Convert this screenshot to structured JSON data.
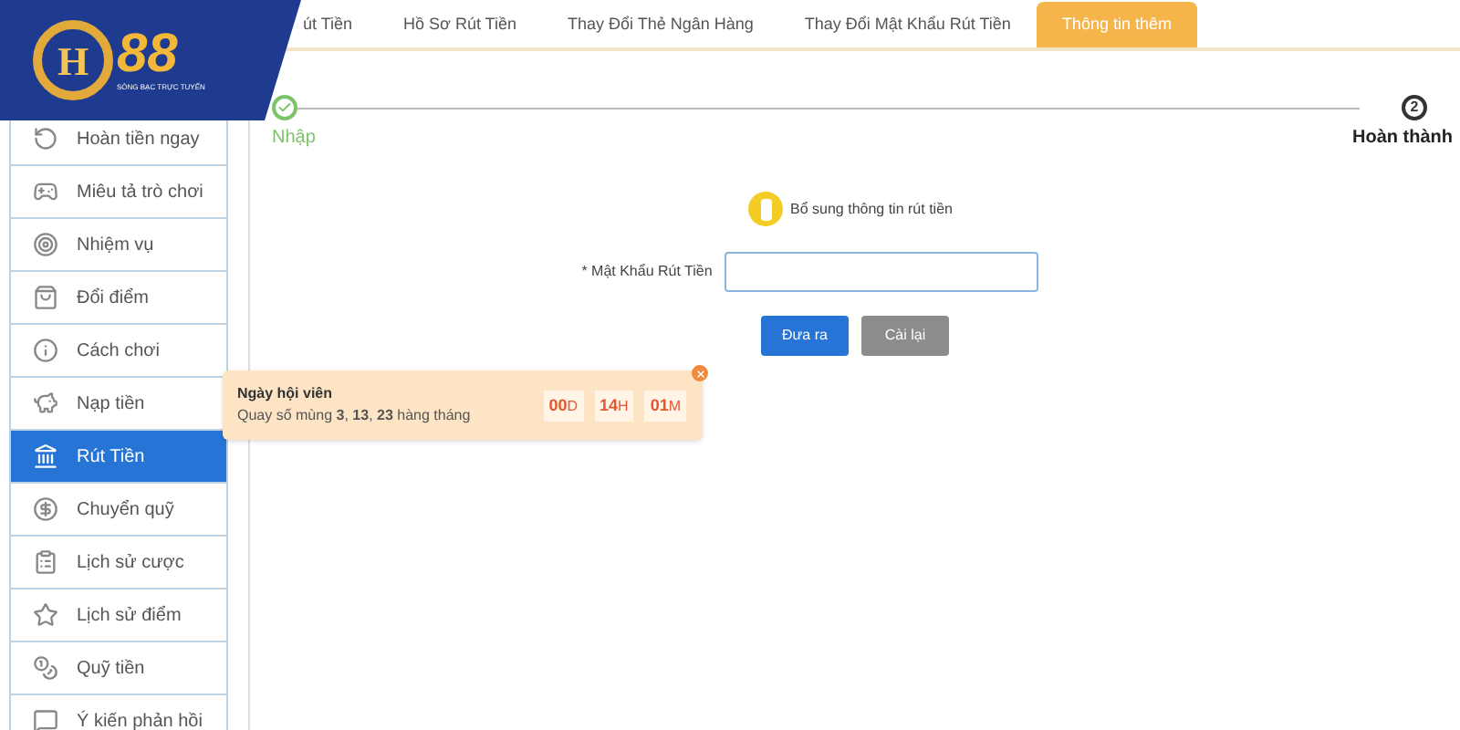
{
  "logo": {
    "letter": "H",
    "number": "88",
    "tagline": "SÒNG BẠC TRỰC TUYẾN"
  },
  "tabs": [
    {
      "label": "út Tiền",
      "selected": false
    },
    {
      "label": "Hồ Sơ Rút Tiền",
      "selected": false
    },
    {
      "label": "Thay Đổi Thẻ Ngân Hàng",
      "selected": false
    },
    {
      "label": "Thay Đổi Mật Khẩu Rút Tiền",
      "selected": false
    },
    {
      "label": "Thông tin thêm",
      "selected": true
    }
  ],
  "sidebar": {
    "items": [
      {
        "label": "Hoàn tiền ngay",
        "selected": false
      },
      {
        "label": "Miêu tả trò chơi",
        "selected": false
      },
      {
        "label": "Nhiệm vụ",
        "selected": false
      },
      {
        "label": "Đổi điểm",
        "selected": false
      },
      {
        "label": "Cách chơi",
        "selected": false
      },
      {
        "label": "Nạp tiền",
        "selected": false
      },
      {
        "label": "Rút Tiền",
        "selected": true
      },
      {
        "label": "Chuyển quỹ",
        "selected": false
      },
      {
        "label": "Lịch sử cược",
        "selected": false
      },
      {
        "label": "Lịch sử điểm",
        "selected": false
      },
      {
        "label": "Quỹ tiền",
        "selected": false
      },
      {
        "label": "Ý kiến phản hồi",
        "selected": false
      }
    ]
  },
  "steps": [
    {
      "label": "Nhập",
      "done": true
    },
    {
      "label": "Hoàn thành",
      "marker": "2",
      "done": false
    }
  ],
  "notice": "Bổ sung thông tin rút tiền",
  "form": {
    "label": "* Mật Khẩu Rút Tiền"
  },
  "buttons": [
    {
      "label": "Đưa ra",
      "kind": "primary"
    },
    {
      "label": "Cài lại",
      "kind": "secondary"
    }
  ],
  "promo": {
    "title": "Ngày hội viên",
    "text": "Quay số mùng **3**, **13**, **23** hàng tháng",
    "countdown": [
      {
        "value": "00",
        "unit": "D"
      },
      {
        "value": "14",
        "unit": "H"
      },
      {
        "value": "01",
        "unit": "M"
      }
    ]
  }
}
